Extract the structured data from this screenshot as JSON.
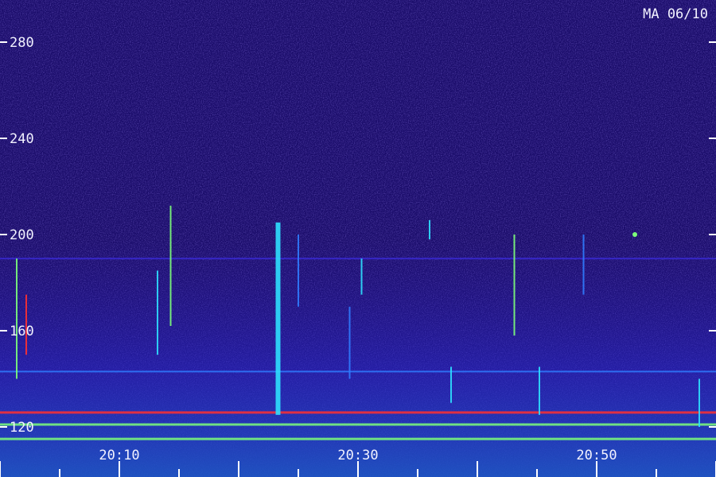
{
  "header": {
    "station_label": "MA 06/10"
  },
  "chart_data": {
    "type": "heatmap",
    "title": "MA 06/10",
    "xlabel": "",
    "ylabel": "",
    "x_ticks": [
      "20:10",
      "20:30",
      "20:50"
    ],
    "x_tick_minutes": [
      10,
      30,
      50
    ],
    "y_ticks": [
      280,
      240,
      200,
      160,
      120
    ],
    "xlim_minutes": [
      0,
      60
    ],
    "ylim": [
      110,
      295
    ],
    "colormap": [
      "#1a0c6a",
      "#2a14a0",
      "#3a2ad6",
      "#2f7cff",
      "#2ee0ff",
      "#7dff7a",
      "#ff3030"
    ],
    "horizontal_bands": [
      {
        "freq": 143,
        "intensity": 0.55
      },
      {
        "freq": 126,
        "intensity": 0.95
      },
      {
        "freq": 121,
        "intensity": 0.8
      },
      {
        "freq": 115,
        "intensity": 0.85
      },
      {
        "freq": 190,
        "intensity": 0.3
      }
    ],
    "vertical_events": [
      {
        "minute": 1.4,
        "from": 140,
        "to": 190,
        "intensity": 0.9
      },
      {
        "minute": 2.2,
        "from": 150,
        "to": 175,
        "intensity": 0.95
      },
      {
        "minute": 14.3,
        "from": 162,
        "to": 212,
        "intensity": 0.85
      },
      {
        "minute": 13.2,
        "from": 150,
        "to": 185,
        "intensity": 0.6
      },
      {
        "minute": 23.3,
        "from": 125,
        "to": 205,
        "intensity": 0.7
      },
      {
        "minute": 25,
        "from": 170,
        "to": 200,
        "intensity": 0.5
      },
      {
        "minute": 29.3,
        "from": 140,
        "to": 170,
        "intensity": 0.55
      },
      {
        "minute": 30.3,
        "from": 175,
        "to": 190,
        "intensity": 0.6
      },
      {
        "minute": 36,
        "from": 198,
        "to": 206,
        "intensity": 0.6
      },
      {
        "minute": 37.8,
        "from": 130,
        "to": 145,
        "intensity": 0.7
      },
      {
        "minute": 43.1,
        "from": 158,
        "to": 200,
        "intensity": 0.75
      },
      {
        "minute": 45.2,
        "from": 125,
        "to": 145,
        "intensity": 0.6
      },
      {
        "minute": 48.9,
        "from": 175,
        "to": 200,
        "intensity": 0.55
      },
      {
        "minute": 58.6,
        "from": 120,
        "to": 140,
        "intensity": 0.6
      }
    ],
    "spots": [
      {
        "minute": 53.2,
        "freq": 200,
        "intensity": 0.85
      }
    ]
  }
}
